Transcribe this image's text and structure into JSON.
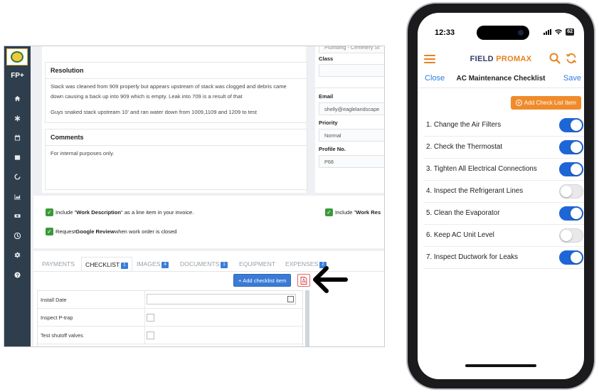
{
  "desktop": {
    "sidebar": {
      "fp_label": "FP+",
      "icons": [
        "home-icon",
        "asterisk-icon",
        "calendar-icon",
        "database-icon",
        "spinner-icon",
        "chart-icon",
        "money-icon",
        "clock-icon",
        "gear-icon",
        "help-icon"
      ]
    },
    "top_partial_text": "Plumbing - Cemetery St",
    "resolution": {
      "header": "Resolution",
      "line1": "Stack was cleaned from 909 properly but appears upstream of stack was clogged and debris came",
      "line2": "down causing a back up into 909 which is empty.  Leak into 709 is a result of that",
      "line3": "Guys snaked stack upstream 10' and ran water down from 1009,1109 and 1209 to test"
    },
    "comments": {
      "header": "Comments",
      "text": "For internal purposes only."
    },
    "fields": {
      "class_label": "Class",
      "class_value": "",
      "email_label": "Email",
      "email_value": "shelly@eaglelandscape",
      "priority_label": "Priority",
      "priority_value": "Normal",
      "profile_label": "Profile No.",
      "profile_value": "P68"
    },
    "includes": {
      "work_desc_pre": "Include \"",
      "work_desc_bold": "Work Description",
      "work_desc_post": "\" as a line item in your invoice.",
      "work_res_pre": "Include \"",
      "work_res_bold": "Work Res",
      "review_pre": "Request ",
      "review_bold": "Google Review",
      "review_post": " when work order is closed"
    },
    "tabs": [
      {
        "label": "PAYMENTS",
        "badge": ""
      },
      {
        "label": "CHECKLIST",
        "badge": "1"
      },
      {
        "label": "IMAGES",
        "badge": "4"
      },
      {
        "label": "DOCUMENTS",
        "badge": "1"
      },
      {
        "label": "EQUIPMENT",
        "badge": ""
      },
      {
        "label": "EXPENSES",
        "badge": "2"
      }
    ],
    "add_checklist_label": "+ Add checklist item",
    "checklist_rows": [
      "Install Date",
      "Inspect P-trap",
      "Test shutoff valves"
    ]
  },
  "phone": {
    "time": "12:33",
    "battery": "62",
    "brand_field": "FIELD ",
    "brand_promax": "PROMAX",
    "nav": {
      "close": "Close",
      "title": "AC Maintenance Checklist",
      "save": "Save"
    },
    "add_item_label": "Add Check List Item",
    "items": [
      {
        "label": "1. Change the Air Filters",
        "on": true
      },
      {
        "label": "2. Check the Thermostat",
        "on": true
      },
      {
        "label": "3. Tighten All Electrical Connections",
        "on": true
      },
      {
        "label": "4. Inspect the Refrigerant Lines",
        "on": false
      },
      {
        "label": "5. Clean the Evaporator",
        "on": true
      },
      {
        "label": "6. Keep AC Unit Level",
        "on": false
      },
      {
        "label": "7. Inspect Ductwork for Leaks",
        "on": true
      }
    ]
  },
  "colors": {
    "sidebar": "#2f3e4c",
    "desktop_button": "#3a7bd5",
    "phone_accent": "#f08b2b",
    "toggle_on": "#1e66d6",
    "brand_navy": "#2f3e66"
  }
}
